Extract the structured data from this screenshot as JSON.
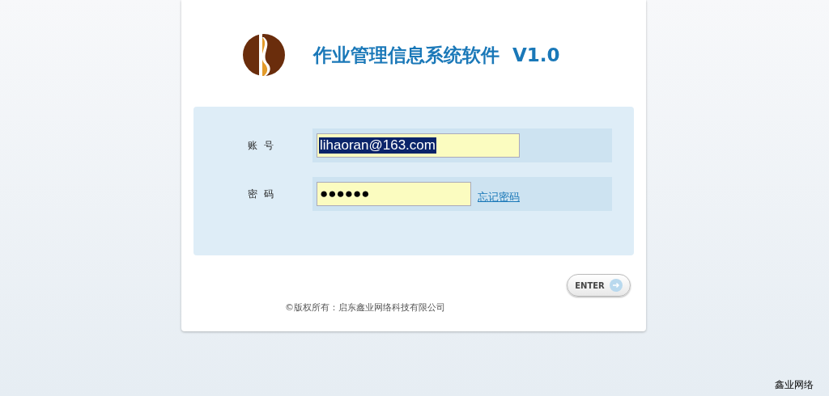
{
  "header": {
    "title": "作业管理信息系统软件  V1.0"
  },
  "form": {
    "fields": [
      {
        "kind": "text",
        "label": "账  号",
        "value": "lihaoran@163.com",
        "text_selected": true
      },
      {
        "kind": "password",
        "label": "密  码",
        "value": "●●●●●●",
        "text_selected": false,
        "link": "忘记密码"
      }
    ]
  },
  "enter_button": "ENTER",
  "copyright": "©版权所有：启东鑫业网络科技有限公司",
  "corner_label": "鑫业网络"
}
